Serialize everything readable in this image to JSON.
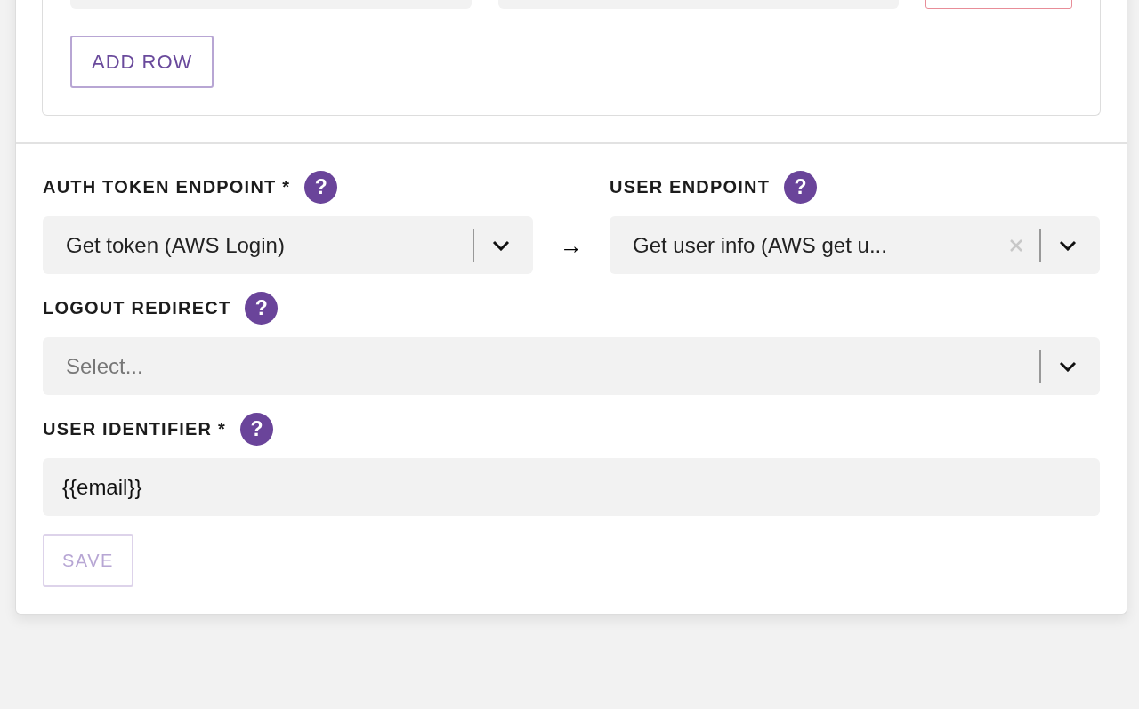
{
  "add_row_button": "ADD ROW",
  "endpoints": {
    "arrow": "→",
    "items": [
      {
        "kind": "select",
        "label": "AUTH TOKEN ENDPOINT *",
        "help": "?",
        "value": "Get token (AWS Login)",
        "clearable": false
      },
      {
        "kind": "select",
        "label": "USER ENDPOINT",
        "help": "?",
        "value": "Get user info (AWS get u...",
        "clearable": true
      }
    ]
  },
  "fields": [
    {
      "kind": "select",
      "label": "LOGOUT REDIRECT",
      "help": "?",
      "placeholder": "Select...",
      "clearable": false
    },
    {
      "kind": "text",
      "label": "USER IDENTIFIER *",
      "help": "?",
      "value": "{{email}}"
    }
  ],
  "save_button": {
    "label": "SAVE",
    "disabled": true
  }
}
